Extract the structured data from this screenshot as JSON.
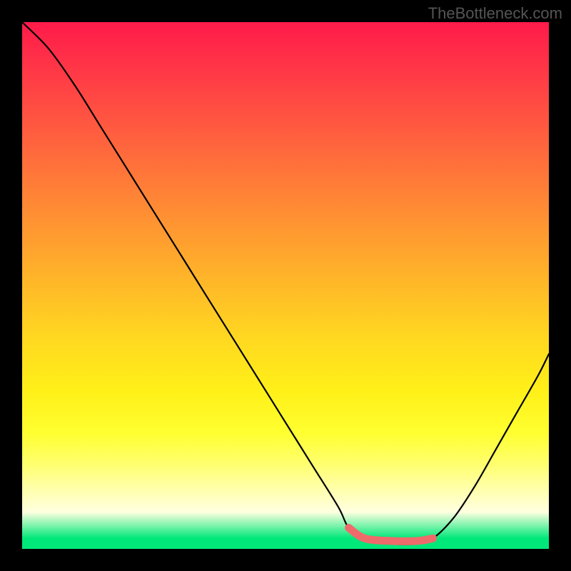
{
  "watermark": "TheBottleneck.com",
  "chart_data": {
    "type": "line",
    "title": "",
    "xlabel": "",
    "ylabel": "",
    "xlim": [
      0,
      100
    ],
    "ylim": [
      0,
      100
    ],
    "grid": false,
    "legend": false,
    "background_gradient": {
      "top": "#ff1a4a",
      "mid": "#fff018",
      "bottom": "#00e87a"
    },
    "series": [
      {
        "name": "curve",
        "color": "#000000",
        "x": [
          0,
          5,
          10,
          15,
          20,
          25,
          30,
          35,
          40,
          45,
          50,
          55,
          60,
          62,
          65,
          70,
          75,
          78,
          82,
          86,
          90,
          94,
          98,
          100
        ],
        "y": [
          100,
          95,
          88,
          80,
          72,
          64,
          56,
          48,
          40,
          32,
          24,
          16,
          8,
          4,
          2,
          1,
          1,
          2,
          6,
          12,
          19,
          26,
          33,
          37
        ]
      }
    ],
    "highlight_segment": {
      "color": "#ef6b6b",
      "x_range": [
        62,
        78
      ],
      "y": 1.5,
      "description": "Thick red segment at trough region"
    }
  }
}
